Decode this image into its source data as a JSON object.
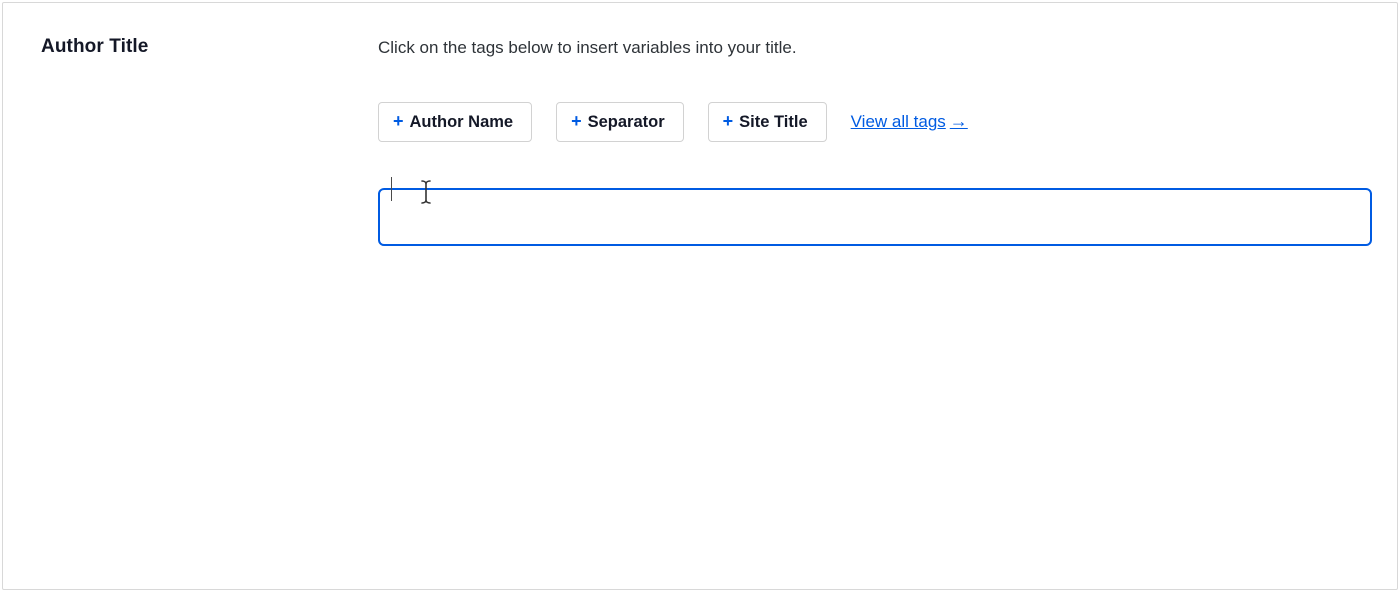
{
  "section": {
    "label": "Author Title",
    "hint": "Click on the tags below to insert variables into your title."
  },
  "tags": {
    "items": [
      {
        "label": "Author Name"
      },
      {
        "label": "Separator"
      },
      {
        "label": "Site Title"
      }
    ],
    "plus_glyph": "+",
    "view_all": "View all tags",
    "arrow_glyph": "→"
  },
  "input": {
    "value": ""
  },
  "colors": {
    "accent": "#005be2",
    "text": "#141827",
    "border": "#d2d2d2"
  }
}
